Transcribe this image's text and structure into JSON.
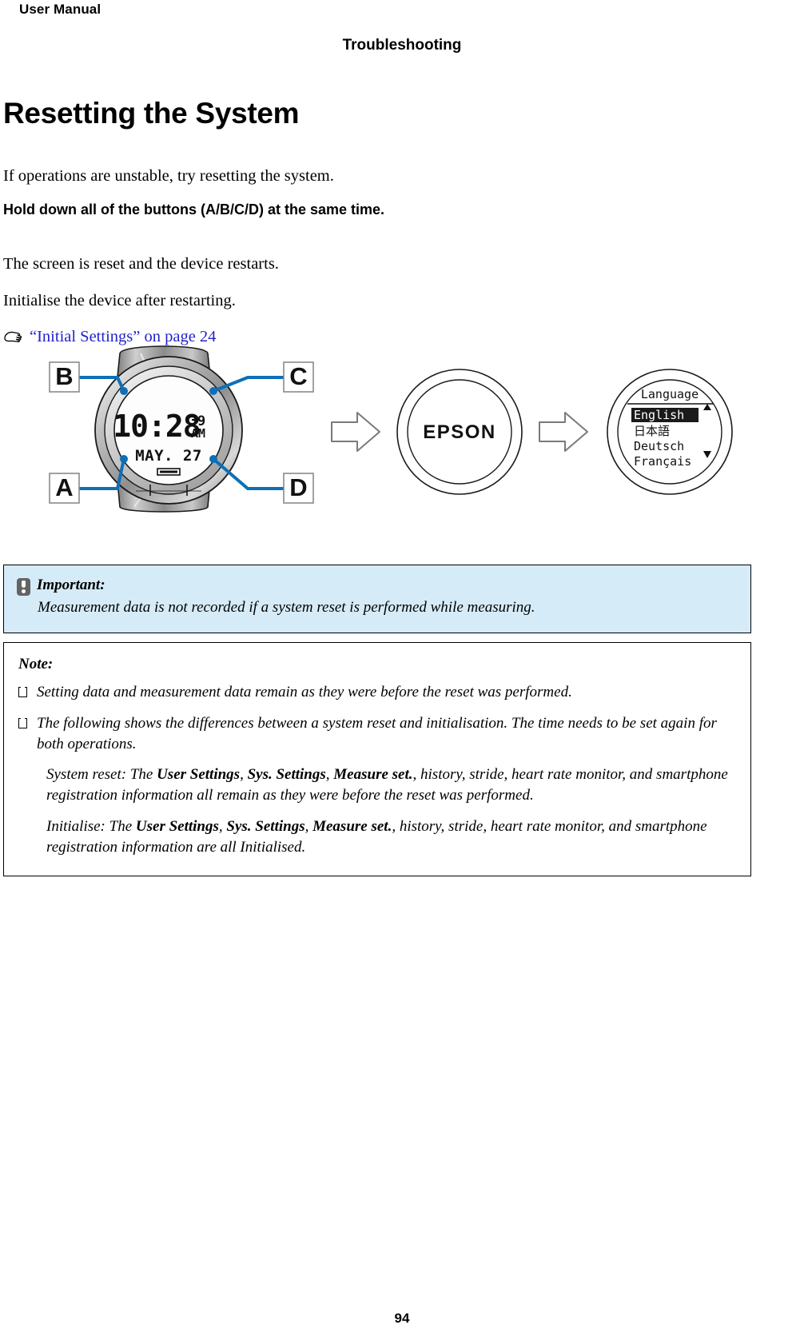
{
  "header": {
    "manual_label": "User Manual",
    "chapter": "Troubleshooting"
  },
  "main": {
    "title": "Resetting the System",
    "intro": "If operations are unstable, try resetting the system.",
    "instruction": "Hold down all of the buttons (A/B/C/D) at the same time.",
    "result_1": "The screen is reset and the device restarts.",
    "result_2": "Initialise the device after restarting.",
    "cross_reference": "“Initial Settings” on page 24",
    "cross_reference_icon": "pointing-hand-icon",
    "link_color": "#2222cc"
  },
  "figure": {
    "callouts": [
      "B",
      "C",
      "A",
      "D"
    ],
    "watch_display": {
      "time": "10:28",
      "seconds": "39",
      "meridiem": "AM",
      "date": "MAY. 27"
    },
    "splash_screen": {
      "logo_text": "EPSON"
    },
    "language_screen": {
      "title": "Language",
      "options": [
        "English",
        "日本語",
        "Deutsch",
        "Français"
      ],
      "selected": "English",
      "scroll_up_icon": "triangle-up-icon",
      "scroll_down_icon": "triangle-down-icon"
    },
    "arrow_icon": "right-arrow-icon"
  },
  "important": {
    "icon": "exclamation-icon",
    "title": "Important:",
    "text": "Measurement data is not recorded if a system reset is performed while measuring.",
    "background_color": "#d5ecf8"
  },
  "note": {
    "title": "Note:",
    "items": [
      "Setting data and measurement data remain as they were before the reset was performed.",
      "The following shows the differences between a system reset and initialisation. The time needs to be set again for both operations."
    ],
    "paragraphs": [
      {
        "lead": "System reset: The ",
        "bold_1": "User Settings",
        "sep_1": ", ",
        "bold_2": "Sys. Settings",
        "sep_2": ", ",
        "bold_3": "Measure set.",
        "tail": ", history, stride, heart rate monitor, and smartphone registration information all remain as they were before the reset was performed."
      },
      {
        "lead": "Initialise: The ",
        "bold_1": "User Settings",
        "sep_1": ", ",
        "bold_2": "Sys. Settings",
        "sep_2": ", ",
        "bold_3": "Measure set.",
        "tail": ", history, stride, heart rate monitor, and smartphone registration information are all Initialised."
      }
    ]
  },
  "footer": {
    "page_number": "94"
  }
}
